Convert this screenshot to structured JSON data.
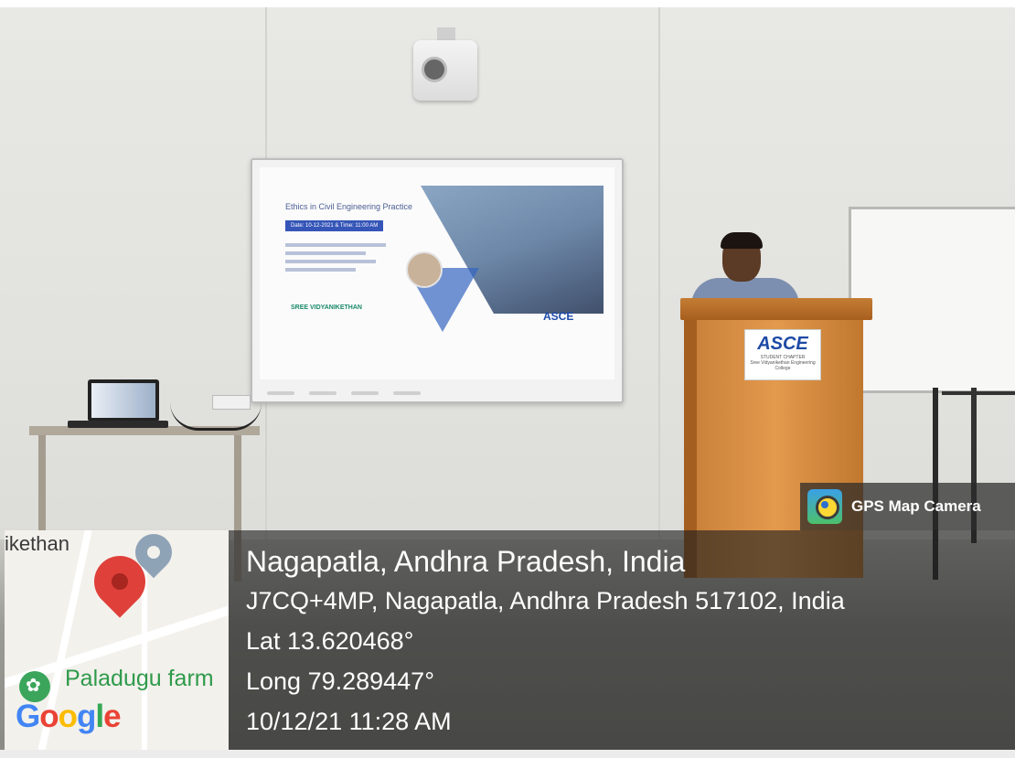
{
  "overlay": {
    "app_name": "GPS Map Camera",
    "place_title": "Nagapatla, Andhra Pradesh, India",
    "address": "J7CQ+4MP, Nagapatla, Andhra Pradesh 517102, India",
    "latitude": "Lat 13.620468°",
    "longitude": "Long 79.289447°",
    "datetime": "10/12/21 11:28 AM"
  },
  "map": {
    "place_label": "ikethan",
    "poi_label": "Paladugu farm",
    "provider_logo": [
      "G",
      "o",
      "o",
      "g",
      "l",
      "e"
    ]
  },
  "podium": {
    "sign": "ASCE",
    "sign_sub1": "STUDENT CHAPTER",
    "sign_sub2": "Sree Vidyanikethan Engineering College"
  },
  "slide": {
    "title": "Ethics in Civil Engineering Practice",
    "date": "Date: 10-12-2021 & Time: 11:00 AM",
    "logo": "SREE VIDYANIKETHAN",
    "brand": "ASCE"
  }
}
